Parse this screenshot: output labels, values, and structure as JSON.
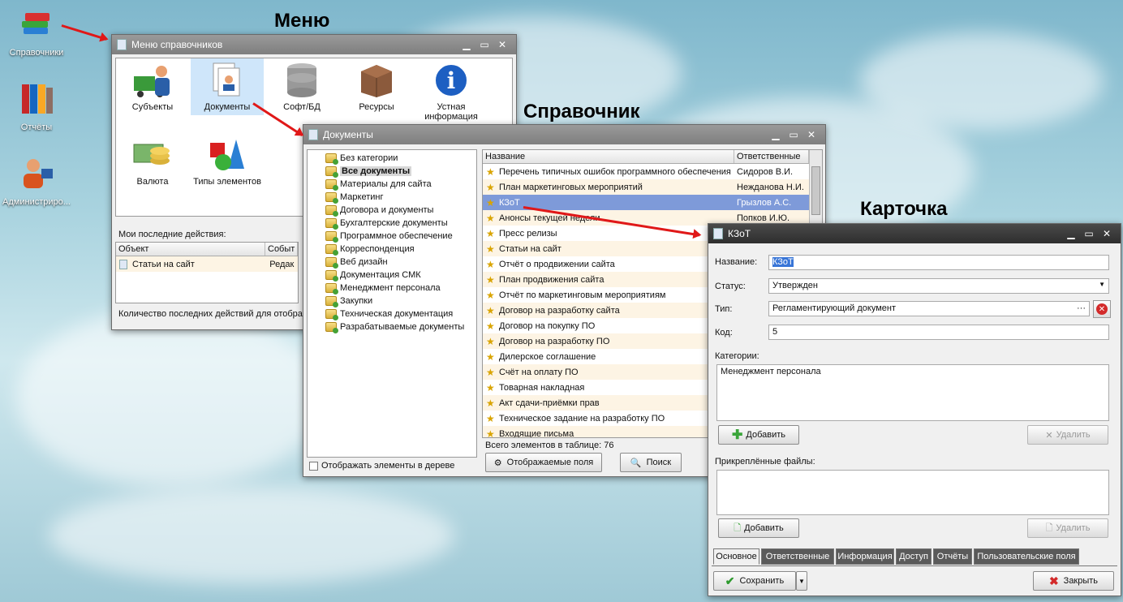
{
  "desktop": {
    "icons": [
      {
        "label": "Справочники"
      },
      {
        "label": "Отчёты"
      },
      {
        "label": "Администриро..."
      }
    ]
  },
  "headings": {
    "menu": "Меню",
    "reference": "Справочник",
    "card": "Карточка"
  },
  "menu_window": {
    "title": "Меню справочников",
    "items": [
      {
        "label": "Субъекты"
      },
      {
        "label": "Документы"
      },
      {
        "label": "Софт/БД"
      },
      {
        "label": "Ресурсы"
      },
      {
        "label": "Устная информация"
      },
      {
        "label": "Валюта"
      },
      {
        "label": "Типы элементов"
      }
    ],
    "recent_label": "Мои последние действия:",
    "columns": [
      "Объект",
      "Событ"
    ],
    "recent_rows": [
      {
        "object": "Статьи на сайт",
        "event": "Редак"
      }
    ],
    "footer": "Количество последних действий для отобра"
  },
  "docs_window": {
    "title": "Документы",
    "tree": [
      "Без категории",
      "Все документы",
      "Материалы для сайта",
      "Маркетинг",
      "Договора и документы",
      "Бухгалтерские документы",
      "Программное обеспечение",
      "Корреспонденция",
      "Веб дизайн",
      "Документация СМК",
      "Менеджмент персонала",
      "Закупки",
      "Техническая документация",
      "Разрабатываемые документы"
    ],
    "show_in_tree": "Отображать элементы в дереве",
    "columns": [
      "Название",
      "Ответственные"
    ],
    "rows": [
      {
        "name": "Перечень типичных ошибок программного обеспечения",
        "resp": "Сидоров В.И."
      },
      {
        "name": "План маркетинговых мероприятий",
        "resp": "Нежданова Н.И."
      },
      {
        "name": "КЗоТ",
        "resp": "Грызлов А.С."
      },
      {
        "name": "Анонсы текущей недели",
        "resp": "Попков И.Ю."
      },
      {
        "name": "Пресс релизы",
        "resp": ""
      },
      {
        "name": "Статьи на сайт",
        "resp": ""
      },
      {
        "name": "Отчёт о продвижении сайта",
        "resp": ""
      },
      {
        "name": "План продвижения сайта",
        "resp": ""
      },
      {
        "name": "Отчёт по маркетинговым мероприятиям",
        "resp": ""
      },
      {
        "name": "Договор на разработку сайта",
        "resp": ""
      },
      {
        "name": "Договор на покупку ПО",
        "resp": ""
      },
      {
        "name": "Договор на разработку ПО",
        "resp": ""
      },
      {
        "name": "Дилерское соглашение",
        "resp": ""
      },
      {
        "name": "Счёт на оплату ПО",
        "resp": ""
      },
      {
        "name": "Товарная накладная",
        "resp": ""
      },
      {
        "name": "Акт сдачи-приёмки прав",
        "resp": ""
      },
      {
        "name": "Техническое задание на разработку ПО",
        "resp": ""
      },
      {
        "name": "Входящие письма",
        "resp": ""
      }
    ],
    "total": "Всего элементов в таблице: 76",
    "fields_button": "Отображаемые поля",
    "search_button": "Поиск"
  },
  "card_window": {
    "title": "КЗоТ",
    "name_label": "Название:",
    "name_value": "КЗоТ",
    "status_label": "Статус:",
    "status_value": "Утвержден",
    "type_label": "Тип:",
    "type_value": "Регламентирующий документ",
    "code_label": "Код:",
    "code_value": "5",
    "categories_label": "Категории:",
    "categories_value": "Менеджмент персонала",
    "add_label": "Добавить",
    "remove_label": "Удалить",
    "files_label": "Прикреплённые файлы:",
    "tabs": [
      "Основное",
      "Ответственные",
      "Информация",
      "Доступ",
      "Отчёты",
      "Пользовательские поля"
    ],
    "save_label": "Сохранить",
    "close_label": "Закрыть"
  },
  "colors": {
    "selection": "#7e9ad9",
    "accent_red": "#e01818"
  }
}
